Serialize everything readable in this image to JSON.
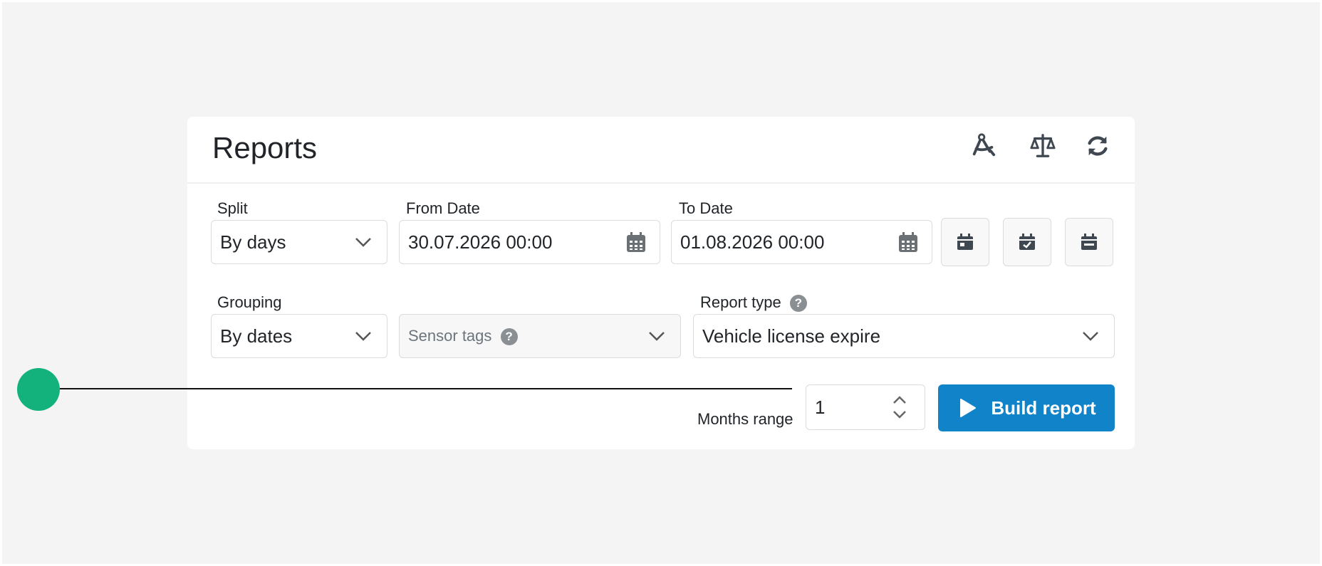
{
  "header": {
    "title": "Reports",
    "icons": [
      "compass-drafting-icon",
      "balance-scale-icon",
      "refresh-icon"
    ]
  },
  "filters": {
    "split": {
      "label": "Split",
      "value": "By days"
    },
    "from_date": {
      "label": "From Date",
      "value": "30.07.2026 00:00"
    },
    "to_date": {
      "label": "To Date",
      "value": "01.08.2026 00:00"
    },
    "grouping": {
      "label": "Grouping",
      "value": "By dates"
    },
    "sensor_tags": {
      "placeholder": "Sensor tags"
    },
    "report_type": {
      "label": "Report type",
      "value": "Vehicle license expire"
    },
    "help_glyph": "?"
  },
  "quick_date_buttons": [
    "calendar-day-icon",
    "calendar-check-icon",
    "calendar-minus-icon"
  ],
  "months_range": {
    "label": "Months range",
    "value": "1"
  },
  "build_button": {
    "label": "Build report"
  },
  "colors": {
    "accent": "#1183c9",
    "callout_marker": "#13b27d",
    "panel_background": "#ffffff",
    "canvas_background": "#f4f4f4"
  }
}
